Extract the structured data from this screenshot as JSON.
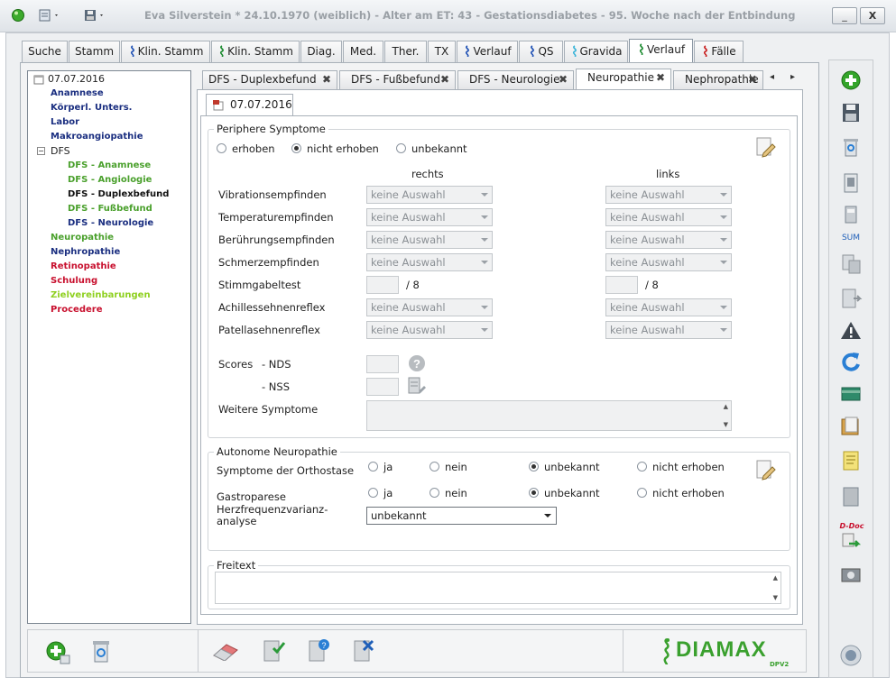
{
  "window": {
    "title": "Eva Silverstein  * 24.10.1970 (weiblich) - Alter am ET: 43 - Gestationsdiabetes - 95. Woche nach der Entbindung",
    "min_label": "_",
    "close_label": "X"
  },
  "main_tabs": [
    {
      "label": "Suche",
      "snake": false
    },
    {
      "label": "Stamm",
      "snake": false
    },
    {
      "label": "Klin. Stamm",
      "snake": true,
      "color": "#1e50b4"
    },
    {
      "label": "Klin. Stamm",
      "snake": true,
      "color": "#1a8a2e"
    },
    {
      "label": "Diag.",
      "snake": false
    },
    {
      "label": "Med.",
      "snake": false
    },
    {
      "label": "Ther.",
      "snake": false
    },
    {
      "label": "TX",
      "snake": false
    },
    {
      "label": "Verlauf",
      "snake": true,
      "color": "#1e50b4"
    },
    {
      "label": "QS",
      "snake": true,
      "color": "#1e50b4"
    },
    {
      "label": "Gravida",
      "snake": true,
      "color": "#3ab4d8"
    },
    {
      "label": "Verlauf",
      "snake": true,
      "color": "#1a8a2e",
      "active": true
    },
    {
      "label": "Fälle",
      "snake": true,
      "color": "#c81e1e"
    }
  ],
  "tree": {
    "root": "07.07.2016",
    "items": [
      {
        "label": "Anamnese",
        "color": "#1a2e80",
        "indent": 1
      },
      {
        "label": "Körperl. Unters.",
        "color": "#1a2e80",
        "indent": 1
      },
      {
        "label": "Labor",
        "color": "#1a2e80",
        "indent": 1
      },
      {
        "label": "Makroangiopathie",
        "color": "#1a2e80",
        "indent": 1
      },
      {
        "label": "DFS",
        "color": "#222222",
        "indent": 1,
        "expander": "−"
      },
      {
        "label": "DFS - Anamnese",
        "color": "#4aa02c",
        "indent": 2
      },
      {
        "label": "DFS - Angiologie",
        "color": "#4aa02c",
        "indent": 2
      },
      {
        "label": "DFS - Duplexbefund",
        "color": "#111111",
        "indent": 2
      },
      {
        "label": "DFS - Fußbefund",
        "color": "#4aa02c",
        "indent": 2
      },
      {
        "label": "DFS - Neurologie",
        "color": "#1a2e80",
        "indent": 2
      },
      {
        "label": "Neuropathie",
        "color": "#4aa02c",
        "indent": 1
      },
      {
        "label": "Nephropathie",
        "color": "#1a2e80",
        "indent": 1
      },
      {
        "label": "Retinopathie",
        "color": "#c8102e",
        "indent": 1
      },
      {
        "label": "Schulung",
        "color": "#c8102e",
        "indent": 1
      },
      {
        "label": "Zielvereinbarungen",
        "color": "#8fd020",
        "indent": 1
      },
      {
        "label": "Procedere",
        "color": "#c8102e",
        "indent": 1
      }
    ]
  },
  "sub_tabs": [
    {
      "label": "DFS - Duplexbefund",
      "close": "✖"
    },
    {
      "label": "DFS - Fußbefund",
      "close": "✖"
    },
    {
      "label": "DFS - Neurologie",
      "close": "✖"
    },
    {
      "label": "Neuropathie",
      "close": "✖",
      "active": true
    },
    {
      "label": "Nephropathie",
      "close": "✖"
    }
  ],
  "date_tab": "07.07.2016",
  "periphere": {
    "legend": "Periphere Symptome",
    "radios": [
      {
        "label": "erhoben",
        "on": false
      },
      {
        "label": "nicht erhoben",
        "on": true
      },
      {
        "label": "unbekannt",
        "on": false
      }
    ],
    "col_right": "rechts",
    "col_left": "links",
    "rows": [
      {
        "label": "Vibrationsempfinden",
        "type": "select",
        "right": "keine Auswahl",
        "left": "keine Auswahl"
      },
      {
        "label": "Temperaturempfinden",
        "type": "select",
        "right": "keine Auswahl",
        "left": "keine Auswahl"
      },
      {
        "label": "Berührungsempfinden",
        "type": "select",
        "right": "keine Auswahl",
        "left": "keine Auswahl"
      },
      {
        "label": "Schmerzempfinden",
        "type": "select",
        "right": "keine Auswahl",
        "left": "keine Auswahl"
      },
      {
        "label": "Stimmgabeltest",
        "type": "number",
        "right": "",
        "left": "",
        "suffix": "/ 8"
      },
      {
        "label": "Achillessehnenreflex",
        "type": "select",
        "right": "keine Auswahl",
        "left": "keine Auswahl"
      },
      {
        "label": "Patellasehnenreflex",
        "type": "select",
        "right": "keine Auswahl",
        "left": "keine Auswahl"
      }
    ],
    "scores_label": "Scores",
    "nds_label": "- NDS",
    "nss_label": "- NSS",
    "weitere_label": "Weitere Symptome"
  },
  "autonome": {
    "legend": "Autonome Neuropathie",
    "rows": [
      {
        "label": "Symptome der Orthostase",
        "options": [
          {
            "label": "ja",
            "on": false
          },
          {
            "label": "nein",
            "on": false
          },
          {
            "label": "unbekannt",
            "on": true
          },
          {
            "label": "nicht erhoben",
            "on": false
          }
        ]
      },
      {
        "label": "Gastroparese",
        "options": [
          {
            "label": "ja",
            "on": false
          },
          {
            "label": "nein",
            "on": false
          },
          {
            "label": "unbekannt",
            "on": true
          },
          {
            "label": "nicht erhoben",
            "on": false
          }
        ]
      }
    ],
    "hrv_label_1": "Herzfrequenzvarianz-",
    "hrv_label_2": "analyse",
    "hrv_value": "unbekannt"
  },
  "freitext": {
    "legend": "Freitext",
    "value": ""
  },
  "right_toolbar": {
    "sum_label": "SUM",
    "ddoc_label": "D-Doc"
  },
  "logo": {
    "text": "DIAMAX",
    "sub": "DPV2"
  }
}
